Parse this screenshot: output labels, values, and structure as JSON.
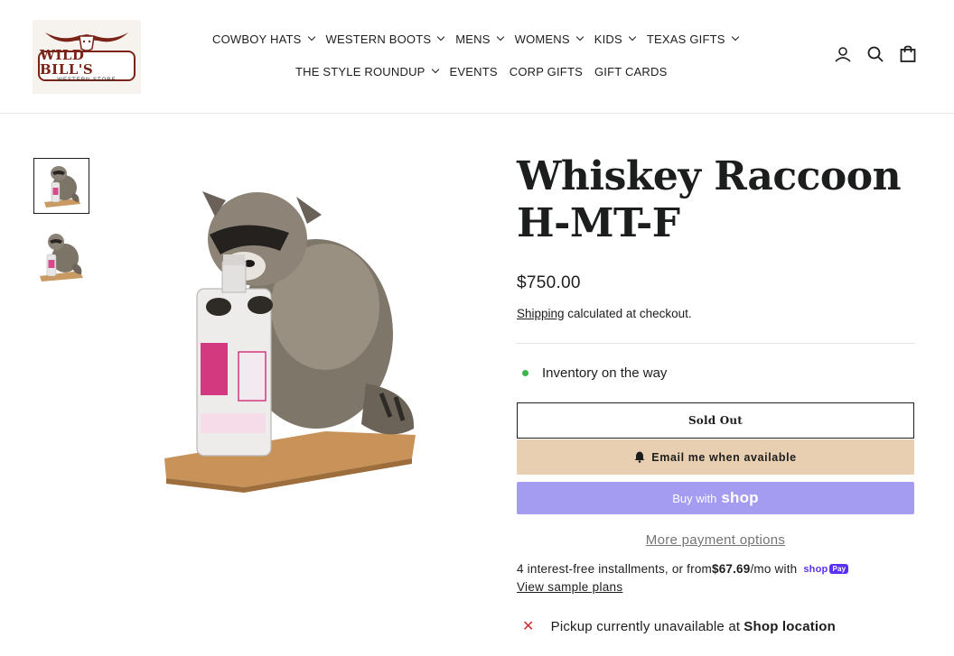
{
  "header": {
    "logo": {
      "title": "WILD BILL'S",
      "subtitle": "WESTERN STORE"
    },
    "nav_row1": [
      {
        "label": "COWBOY HATS",
        "dropdown": true
      },
      {
        "label": "WESTERN BOOTS",
        "dropdown": true
      },
      {
        "label": "MENS",
        "dropdown": true
      },
      {
        "label": "WOMENS",
        "dropdown": true
      },
      {
        "label": "KIDS",
        "dropdown": true
      },
      {
        "label": "TEXAS GIFTS",
        "dropdown": true
      }
    ],
    "nav_row2": [
      {
        "label": "THE STYLE ROUNDUP",
        "dropdown": true
      },
      {
        "label": "EVENTS",
        "dropdown": false
      },
      {
        "label": "CORP GIFTS",
        "dropdown": false
      },
      {
        "label": "GIFT CARDS",
        "dropdown": false
      }
    ],
    "icons": [
      "account-icon",
      "search-icon",
      "cart-icon"
    ]
  },
  "gallery": {
    "thumbnail_count": 2,
    "selected_index": 0
  },
  "product": {
    "title": "Whiskey Raccoon H-MT-F",
    "price": "$750.00",
    "shipping_link": "Shipping",
    "shipping_text": " calculated at checkout.",
    "inventory_status": "Inventory on the way",
    "sold_out_label": "Sold Out",
    "email_label": "Email me when available",
    "shop_buy_prefix": "Buy with",
    "shop_buy_brand": "shop",
    "more_payment": "More payment options",
    "installments_prefix": "4 interest-free installments, or from ",
    "installments_amount": "$67.69",
    "installments_suffix": "/mo with",
    "shoppay_brand": "shop",
    "shoppay_pay": "Pay",
    "sample_plans": "View sample plans",
    "pickup_prefix": "Pickup currently unavailable at",
    "pickup_location": "Shop location"
  },
  "colors": {
    "accent_email": "#e8cfb1",
    "shop_button": "#a39cf0",
    "in_stock_dot": "#3bb54a",
    "unavailable_x": "#d02e2e",
    "logo_red": "#7a2418"
  }
}
